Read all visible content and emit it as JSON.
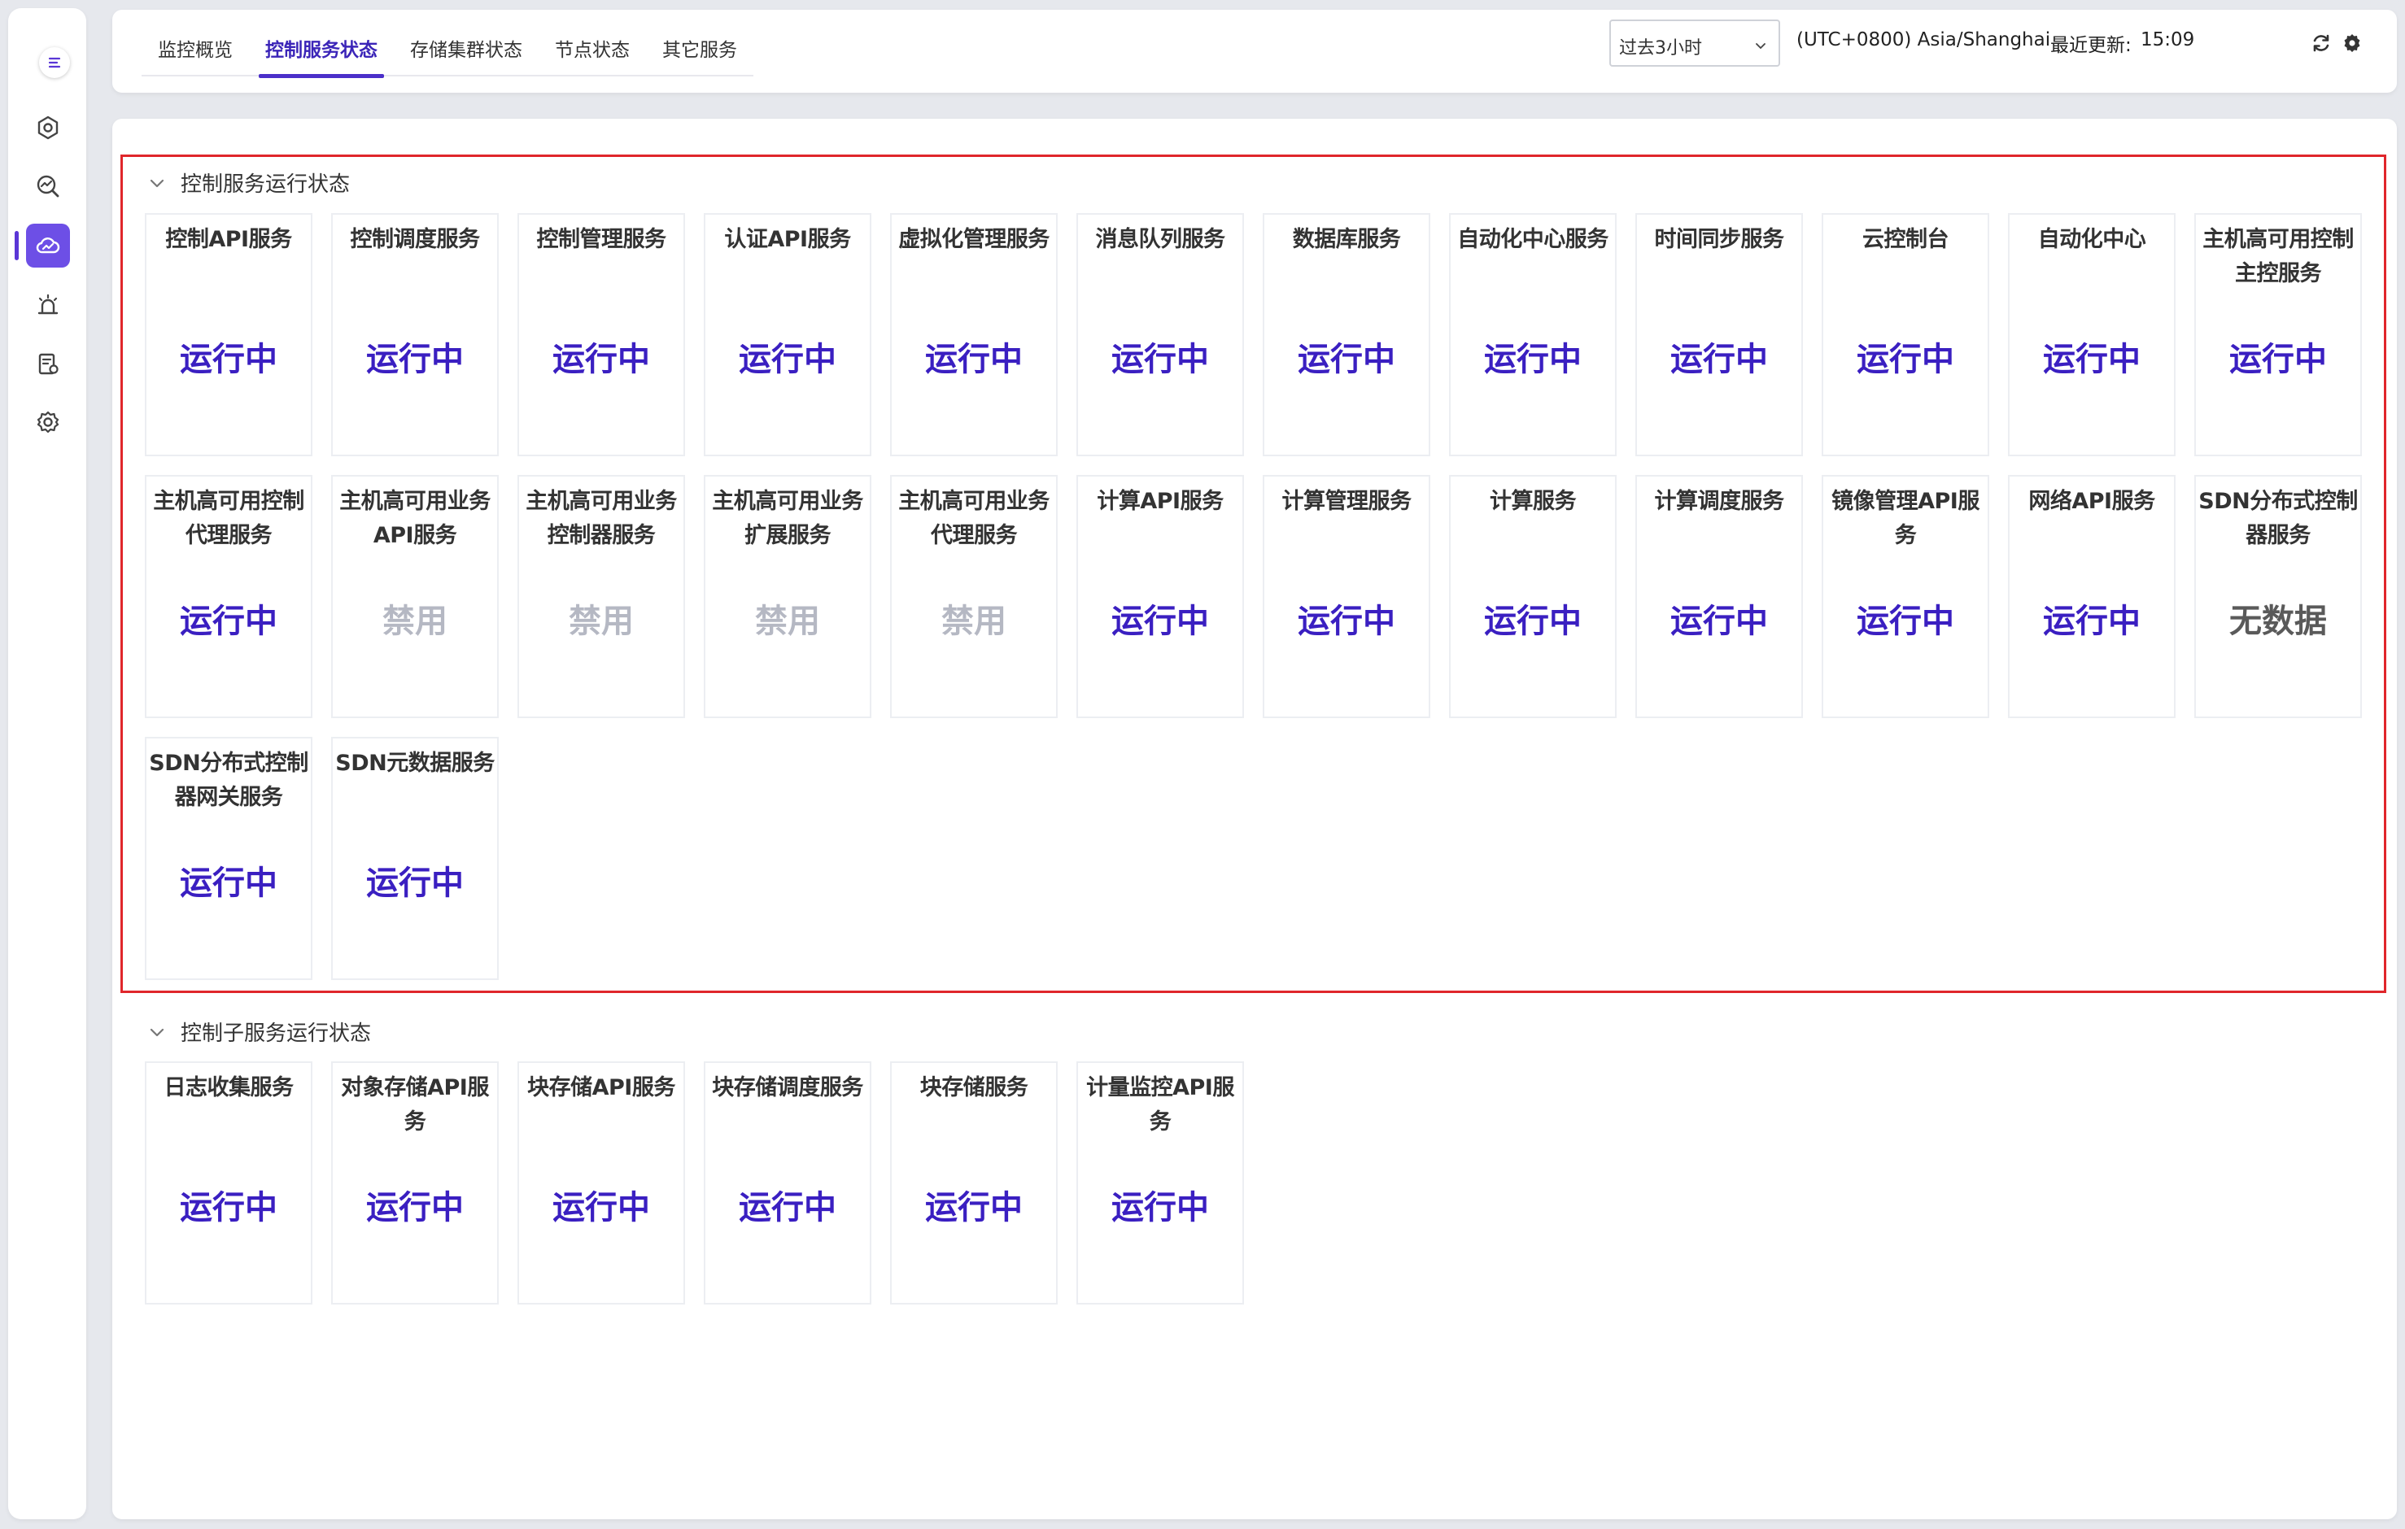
{
  "colors": {
    "accent": "#4b2fc9",
    "running": "#3a1fc1",
    "disabled": "#b5b8c3",
    "nodata": "#5a5a5a",
    "highlight": "#e0262b"
  },
  "sidebar": {
    "menu_icon": "menu-expand-icon",
    "items": [
      {
        "icon": "hexagon-settings-icon",
        "active": false
      },
      {
        "icon": "search-chart-icon",
        "active": false
      },
      {
        "icon": "cloud-monitor-icon",
        "active": true
      },
      {
        "icon": "alarm-light-icon",
        "active": false
      },
      {
        "icon": "clipboard-gear-icon",
        "active": false
      },
      {
        "icon": "gear-icon",
        "active": false
      }
    ]
  },
  "header": {
    "tabs": [
      {
        "label": "监控概览",
        "active": false
      },
      {
        "label": "控制服务状态",
        "active": true
      },
      {
        "label": "存储集群状态",
        "active": false
      },
      {
        "label": "节点状态",
        "active": false
      },
      {
        "label": "其它服务",
        "active": false
      }
    ],
    "time_range": "过去3小时",
    "timezone": "(UTC+0800) Asia/Shanghai",
    "last_update_label": "最近更新:",
    "last_update_time": "15:09"
  },
  "sections": [
    {
      "title": "控制服务运行状态",
      "cards": [
        {
          "title": "控制API服务",
          "status": "运行中",
          "state": "running"
        },
        {
          "title": "控制调度服务",
          "status": "运行中",
          "state": "running"
        },
        {
          "title": "控制管理服务",
          "status": "运行中",
          "state": "running"
        },
        {
          "title": "认证API服务",
          "status": "运行中",
          "state": "running"
        },
        {
          "title": "虚拟化管理服务",
          "status": "运行中",
          "state": "running"
        },
        {
          "title": "消息队列服务",
          "status": "运行中",
          "state": "running"
        },
        {
          "title": "数据库服务",
          "status": "运行中",
          "state": "running"
        },
        {
          "title": "自动化中心服务",
          "status": "运行中",
          "state": "running"
        },
        {
          "title": "时间同步服务",
          "status": "运行中",
          "state": "running"
        },
        {
          "title": "云控制台",
          "status": "运行中",
          "state": "running"
        },
        {
          "title": "自动化中心",
          "status": "运行中",
          "state": "running"
        },
        {
          "title": "主机高可用控制主控服务",
          "status": "运行中",
          "state": "running"
        },
        {
          "title": "主机高可用控制代理服务",
          "status": "运行中",
          "state": "running"
        },
        {
          "title": "主机高可用业务API服务",
          "status": "禁用",
          "state": "disabled"
        },
        {
          "title": "主机高可用业务控制器服务",
          "status": "禁用",
          "state": "disabled"
        },
        {
          "title": "主机高可用业务扩展服务",
          "status": "禁用",
          "state": "disabled"
        },
        {
          "title": "主机高可用业务代理服务",
          "status": "禁用",
          "state": "disabled"
        },
        {
          "title": "计算API服务",
          "status": "运行中",
          "state": "running"
        },
        {
          "title": "计算管理服务",
          "status": "运行中",
          "state": "running"
        },
        {
          "title": "计算服务",
          "status": "运行中",
          "state": "running"
        },
        {
          "title": "计算调度服务",
          "status": "运行中",
          "state": "running"
        },
        {
          "title": "镜像管理API服务",
          "status": "运行中",
          "state": "running"
        },
        {
          "title": "网络API服务",
          "status": "运行中",
          "state": "running"
        },
        {
          "title": "SDN分布式控制器服务",
          "status": "无数据",
          "state": "nodata"
        },
        {
          "title": "SDN分布式控制器网关服务",
          "status": "运行中",
          "state": "running"
        },
        {
          "title": "SDN元数据服务",
          "status": "运行中",
          "state": "running"
        }
      ]
    },
    {
      "title": "控制子服务运行状态",
      "cards": [
        {
          "title": "日志收集服务",
          "status": "运行中",
          "state": "running"
        },
        {
          "title": "对象存储API服务",
          "status": "运行中",
          "state": "running"
        },
        {
          "title": "块存储API服务",
          "status": "运行中",
          "state": "running"
        },
        {
          "title": "块存储调度服务",
          "status": "运行中",
          "state": "running"
        },
        {
          "title": "块存储服务",
          "status": "运行中",
          "state": "running"
        },
        {
          "title": "计量监控API服务",
          "status": "运行中",
          "state": "running"
        }
      ]
    }
  ]
}
